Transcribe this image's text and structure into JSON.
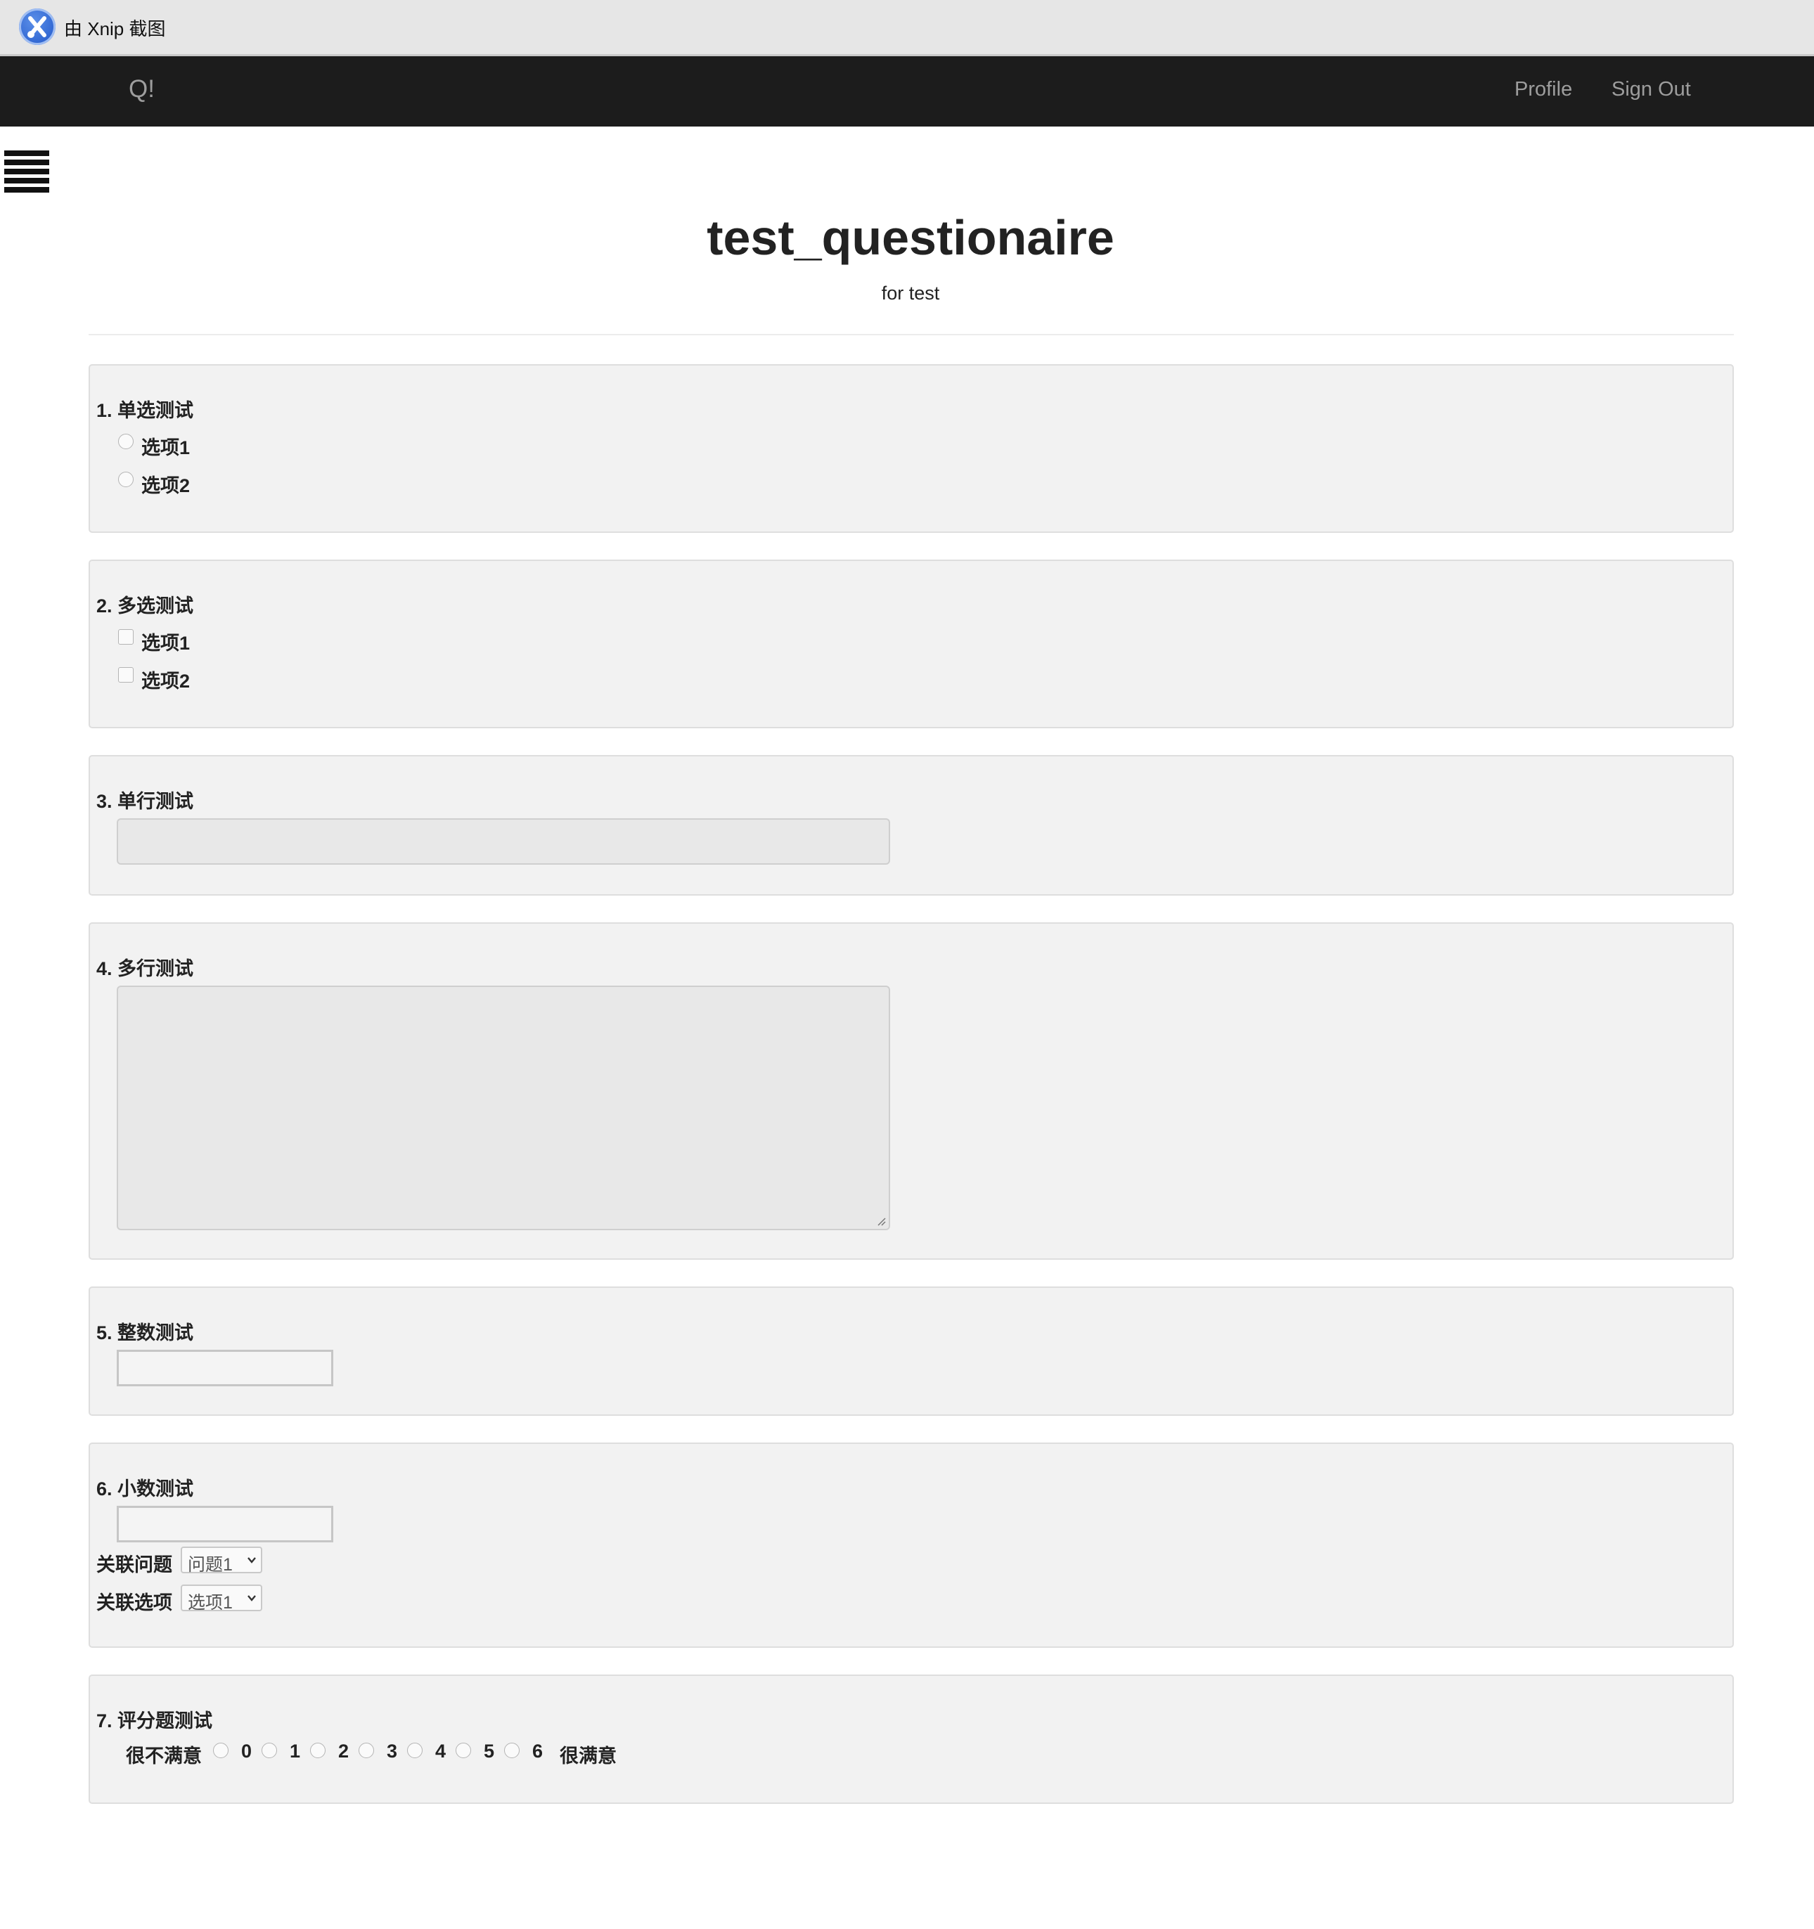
{
  "capture_bar": {
    "text": "由 Xnip 截图"
  },
  "navbar": {
    "brand": "Q!",
    "profile": "Profile",
    "sign_out": "Sign Out"
  },
  "page": {
    "title": "test_questionaire",
    "subtitle": "for test"
  },
  "questions": {
    "q1": {
      "title": "1. 单选测试",
      "options": [
        "选项1",
        "选项2"
      ]
    },
    "q2": {
      "title": "2. 多选测试",
      "options": [
        "选项1",
        "选项2"
      ]
    },
    "q3": {
      "title": "3. 单行测试",
      "value": ""
    },
    "q4": {
      "title": "4. 多行测试",
      "value": ""
    },
    "q5": {
      "title": "5. 整数测试",
      "value": ""
    },
    "q6": {
      "title": "6. 小数测试",
      "value": "",
      "related_question_label": "关联问题",
      "related_question_value": "问题1",
      "related_option_label": "关联选项",
      "related_option_value": "选项1"
    },
    "q7": {
      "title": "7. 评分题测试",
      "low_label": "很不满意",
      "high_label": "很满意",
      "scale": [
        "0",
        "1",
        "2",
        "3",
        "4",
        "5",
        "6"
      ]
    }
  },
  "colors": {
    "navbar_bg": "#1c1c1c",
    "card_bg": "#f2f2f2",
    "nav_text": "#9d9d9d"
  }
}
